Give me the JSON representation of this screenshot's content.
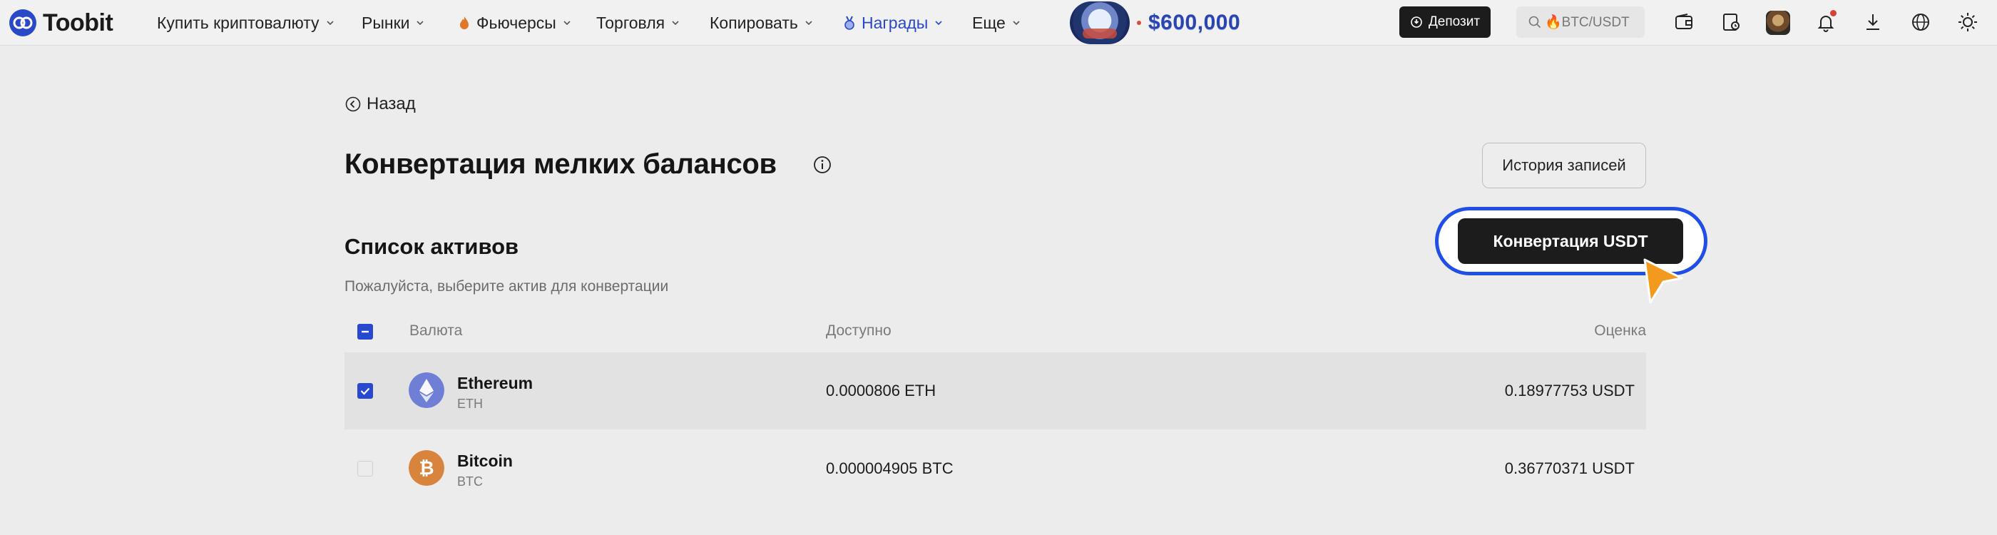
{
  "app": {
    "name": "Toobit"
  },
  "nav": {
    "items": [
      {
        "label": "Купить криптовалюту"
      },
      {
        "label": "Рынки"
      },
      {
        "label": "Фьючерсы"
      },
      {
        "label": "Торговля"
      },
      {
        "label": "Копировать"
      },
      {
        "label": "Награды"
      },
      {
        "label": "Еще"
      }
    ],
    "promo_amount": "$600,000",
    "deposit_label": "Депозит",
    "search_placeholder": "🔥BTC/USDT"
  },
  "page": {
    "back_label": "Назад",
    "title": "Конвертация мелких балансов",
    "history_label": "История записей",
    "section_title": "Список активов",
    "subtitle": "Пожалуйста, выберите актив для конвертации",
    "convert_label": "Конвертация USDT"
  },
  "table": {
    "headers": {
      "currency": "Валюта",
      "available": "Доступно",
      "estimate": "Оценка"
    },
    "rows": [
      {
        "name": "Ethereum",
        "symbol": "ETH",
        "available": "0.0000806 ETH",
        "estimate": "0.18977753 USDT",
        "selected": true,
        "icon": "ethereum-icon"
      },
      {
        "name": "Bitcoin",
        "symbol": "BTC",
        "available": "0.000004905 BTC",
        "estimate": "0.36770371 USDT",
        "selected": false,
        "icon": "bitcoin-icon"
      }
    ]
  },
  "colors": {
    "accent": "#2848d0",
    "highlight_ring": "#1f4fe6",
    "cursor": "#f39a1e",
    "ethereum": "#6f7fd6",
    "bitcoin": "#d9843c"
  }
}
